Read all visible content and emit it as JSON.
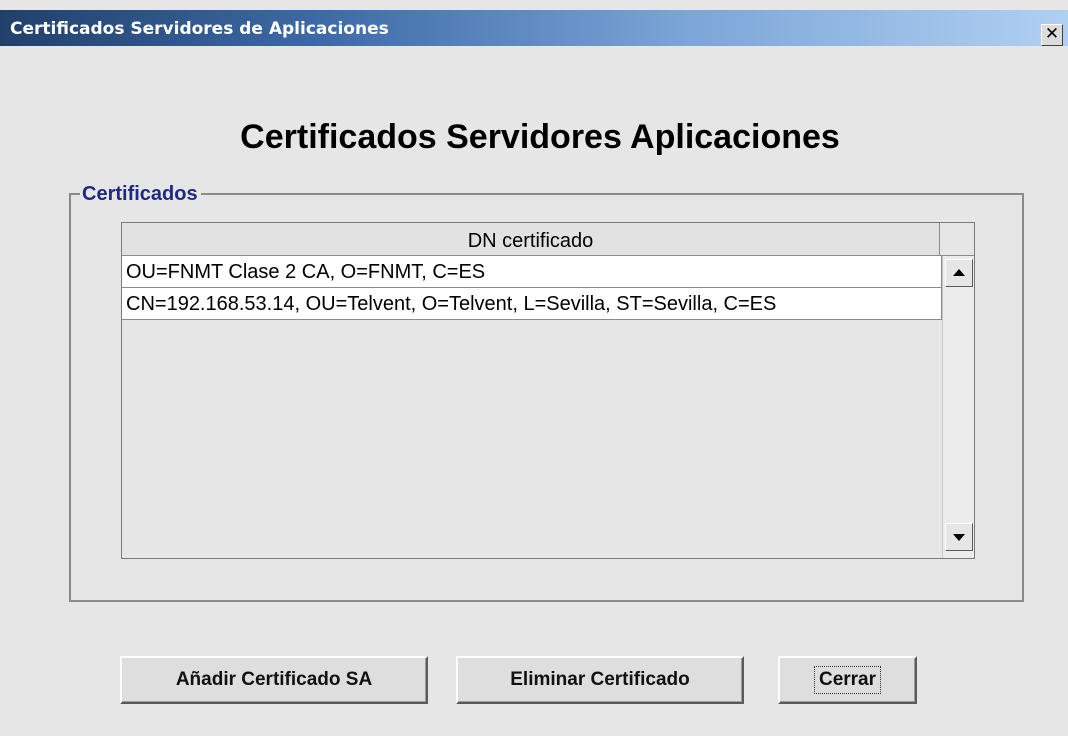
{
  "window": {
    "title": "Certificados Servidores de Aplicaciones",
    "close_label": "✕"
  },
  "main": {
    "heading": "Certificados Servidores Aplicaciones",
    "group_label": "Certificados"
  },
  "table": {
    "columns": [
      "DN certificado"
    ],
    "rows": [
      "OU=FNMT Clase 2 CA, O=FNMT, C=ES",
      "CN=192.168.53.14, OU=Telvent, O=Telvent, L=Sevilla, ST=Sevilla, C=ES"
    ]
  },
  "buttons": {
    "add": "Añadir Certificado SA",
    "remove": "Eliminar Certificado",
    "close": "Cerrar"
  },
  "icons": {
    "close": "close-icon",
    "scroll_up": "scroll-up-arrow-icon",
    "scroll_down": "scroll-down-arrow-icon"
  }
}
